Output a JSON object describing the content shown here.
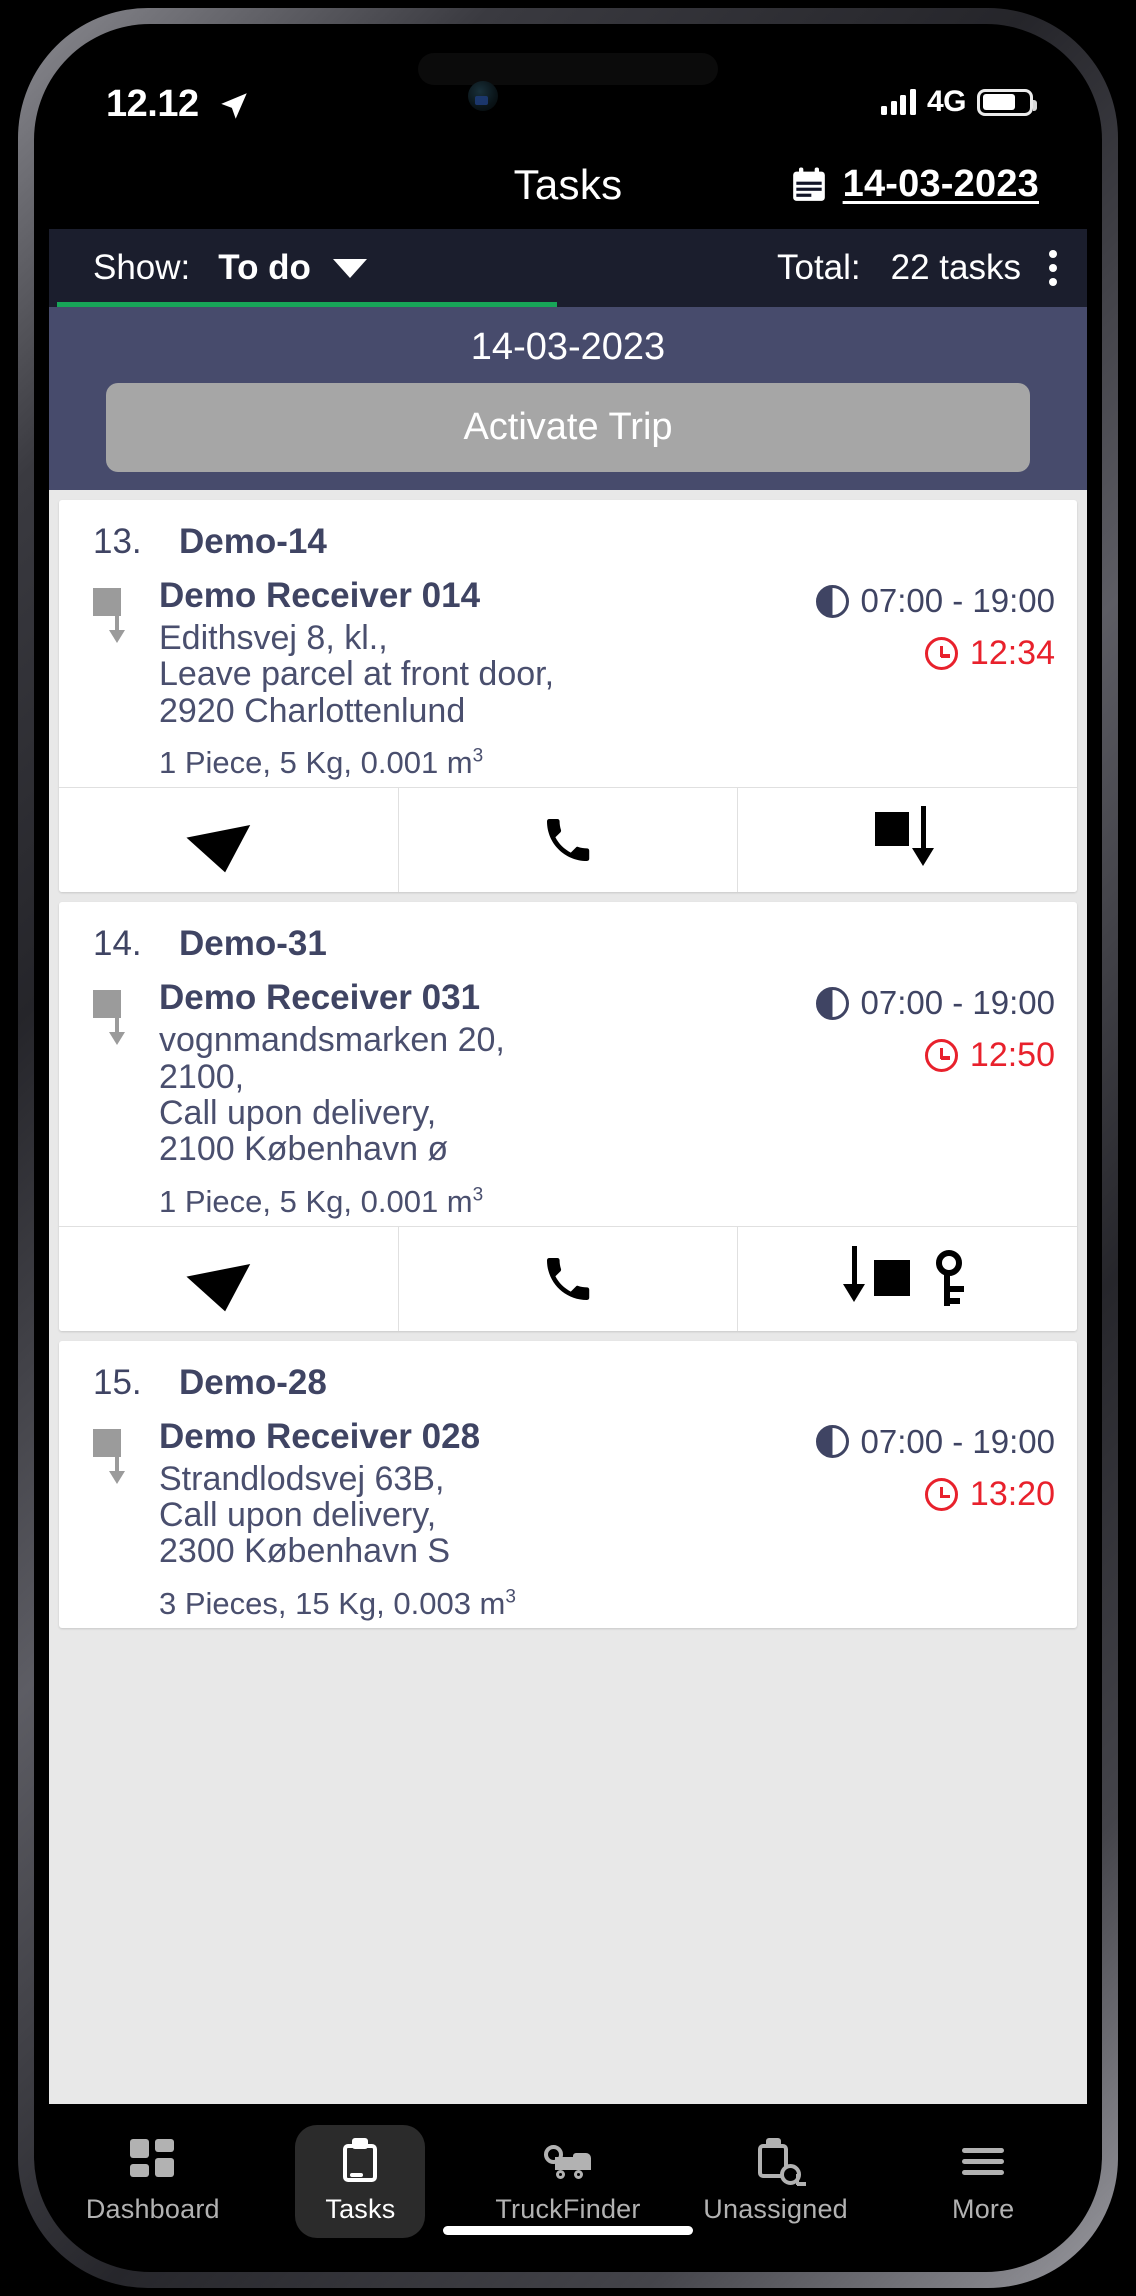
{
  "status_bar": {
    "time": "12.12",
    "network": "4G",
    "location_icon": "location-arrow-icon",
    "signal_icon": "signal-bars-icon",
    "battery_icon": "battery-icon"
  },
  "header": {
    "title": "Tasks",
    "date": "14-03-2023",
    "calendar_icon": "calendar-icon"
  },
  "filter_bar": {
    "show_label": "Show:",
    "show_value": "To do",
    "caret_icon": "chevron-down-icon",
    "total_label": "Total:",
    "total_value": "22 tasks",
    "menu_icon": "kebab-menu-icon",
    "accent_color": "#18a558",
    "background_color": "#1b1e2d"
  },
  "trip": {
    "date": "14-03-2023",
    "activate_label": "Activate Trip",
    "header_color": "#474b6c",
    "button_color": "#a6a6a6"
  },
  "tasks": [
    {
      "seq": "13.",
      "ref": "Demo-14",
      "stop_icon": "delivery-stop-icon",
      "receiver": "Demo Receiver 014",
      "address_lines": [
        "Edithsvej 8, kl.,",
        "Leave parcel at front door,",
        "2920 Charlottenlund"
      ],
      "pieces": "1 Piece, 5 Kg, 0.001 m",
      "pieces_sup": "3",
      "window_icon": "half-clock-icon",
      "window": "07:00 - 19:00",
      "eta_icon": "clock-icon",
      "eta": "12:34",
      "eta_color": "#e8212c",
      "actions": [
        "navigate-icon",
        "call-icon",
        "deliver-icon"
      ]
    },
    {
      "seq": "14.",
      "ref": "Demo-31",
      "stop_icon": "delivery-stop-icon",
      "receiver": "Demo Receiver 031",
      "address_lines": [
        "vognmandsmarken 20,",
        "2100,",
        "Call upon delivery,",
        "2100 København ø"
      ],
      "pieces": "1 Piece, 5 Kg, 0.001 m",
      "pieces_sup": "3",
      "window_icon": "half-clock-icon",
      "window": "07:00 - 19:00",
      "eta_icon": "clock-icon",
      "eta": "12:50",
      "eta_color": "#e8212c",
      "actions": [
        "navigate-icon",
        "call-icon",
        "deliver-key-icon"
      ]
    },
    {
      "seq": "15.",
      "ref": "Demo-28",
      "stop_icon": "delivery-stop-icon",
      "receiver": "Demo Receiver 028",
      "address_lines": [
        "Strandlodsvej 63B,",
        "Call upon delivery,",
        "2300 København S"
      ],
      "pieces": "3 Pieces, 15 Kg, 0.003 m",
      "pieces_sup": "3",
      "window_icon": "half-clock-icon",
      "window": "07:00 - 19:00",
      "eta_icon": "clock-icon",
      "eta": "13:20",
      "eta_color": "#e8212c",
      "actions": []
    }
  ],
  "tabs": [
    {
      "label": "Dashboard",
      "icon": "dashboard-icon",
      "active": false
    },
    {
      "label": "Tasks",
      "icon": "clipboard-icon",
      "active": true
    },
    {
      "label": "TruckFinder",
      "icon": "truck-finder-icon",
      "active": false
    },
    {
      "label": "Unassigned",
      "icon": "unassigned-clipboard-icon",
      "active": false
    },
    {
      "label": "More",
      "icon": "hamburger-icon",
      "active": false
    }
  ]
}
